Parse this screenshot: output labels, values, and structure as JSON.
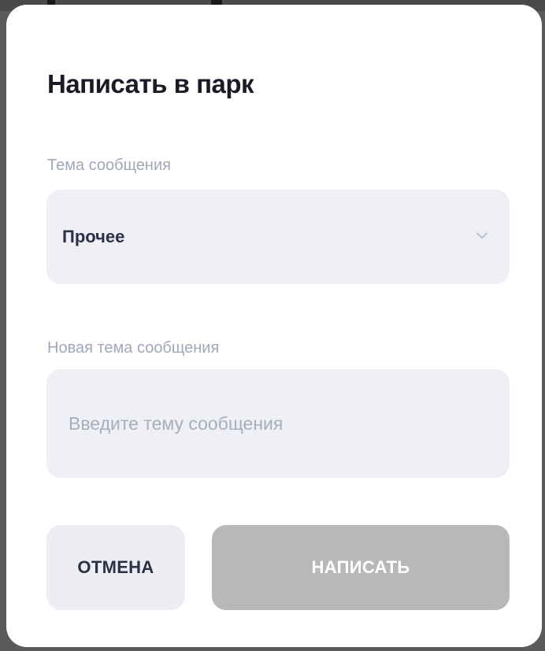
{
  "modal": {
    "title": "Написать в парк",
    "topic_label": "Тема сообщения",
    "topic_selected": "Прочее",
    "new_topic_label": "Новая тема сообщения",
    "new_topic_placeholder": "Введите тему сообщения",
    "new_topic_value": "",
    "cancel_label": "ОТМЕНА",
    "submit_label": "НАПИСАТЬ",
    "submit_enabled": false
  },
  "icons": {
    "dropdown": "chevron-down-icon"
  },
  "colors": {
    "modal_bg": "#ffffff",
    "field_bg": "#eef0f5",
    "title": "#1b1b26",
    "label": "#a2a7b8",
    "submit_disabled_bg": "#b8b8b8",
    "cancel_bg": "#eceef3",
    "overlay": "#5a5a5a"
  }
}
